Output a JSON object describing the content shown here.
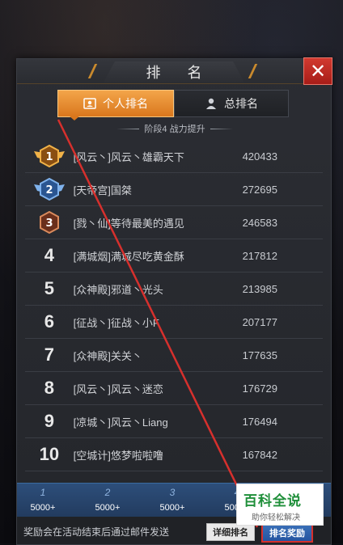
{
  "title": "排 名",
  "close_label": "✕",
  "tabs": [
    {
      "label": "个人排名",
      "icon": "person-card-icon",
      "active": true
    },
    {
      "label": "总排名",
      "icon": "person-icon",
      "active": false
    }
  ],
  "stage_text": "阶段4 战力提升",
  "rankings": [
    {
      "rank": "1",
      "name": "[风云丶]风云丶雄霸天下",
      "score": "420433",
      "badge": "gold-wing-badge-icon"
    },
    {
      "rank": "2",
      "name": "[天帝宫]国桀",
      "score": "272695",
      "badge": "blue-wing-badge-icon"
    },
    {
      "rank": "3",
      "name": "[戮丶仙]等待最美的遇见",
      "score": "246583",
      "badge": "bronze-badge-icon"
    },
    {
      "rank": "4",
      "name": "[满城烟]满城尽吃黄金酥",
      "score": "217812"
    },
    {
      "rank": "5",
      "name": "[众神殿]邪道丶光头",
      "score": "213985"
    },
    {
      "rank": "6",
      "name": "[征战丶]征战丶小F",
      "score": "207177"
    },
    {
      "rank": "7",
      "name": "[众神殿]关关丶",
      "score": "177635"
    },
    {
      "rank": "8",
      "name": "[风云丶]风云丶迷恋",
      "score": "176729"
    },
    {
      "rank": "9",
      "name": "[凉城丶]风云丶Liang",
      "score": "176494"
    },
    {
      "rank": "10",
      "name": "[空城计]悠梦啦啦噜",
      "score": "167842"
    }
  ],
  "rewards": [
    {
      "rank": "1",
      "value": "5000+"
    },
    {
      "rank": "2",
      "value": "5000+"
    },
    {
      "rank": "3",
      "value": "5000+"
    },
    {
      "rank": "4",
      "value": "5000+"
    }
  ],
  "footer_text": "奖励会在活动结束后通过邮件发送",
  "detail_button": "详细排名",
  "reward_button": "排名奖励",
  "watermark": {
    "title": "百科全说",
    "subtitle": "助你轻松解决"
  },
  "colors": {
    "accent": "#d9771d",
    "close": "#d23a30",
    "annotation_line": "#d6302d",
    "watermark_green": "#1f8f3a"
  }
}
